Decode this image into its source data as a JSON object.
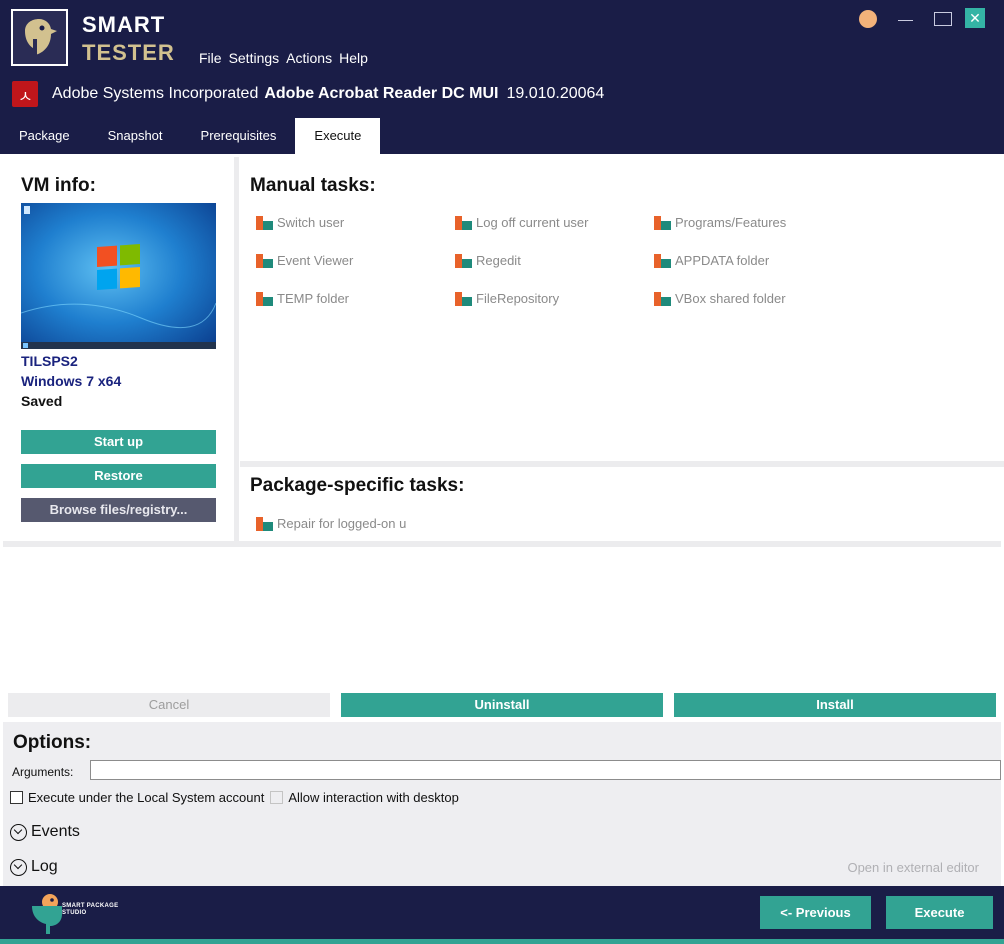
{
  "app": {
    "brand_line1": "SMART",
    "brand_line2": "TESTER",
    "colors": {
      "navy": "#1a1d47",
      "teal": "#32a393",
      "gold": "#d2c18f",
      "task_icon_orange": "#e8622a",
      "task_icon_teal": "#1f8a7b"
    }
  },
  "menu": [
    "File",
    "Settings",
    "Actions",
    "Help"
  ],
  "window_controls": {
    "user": "user-icon",
    "minimize": "minimize-icon",
    "maximize": "maximize-icon",
    "close": "close-icon",
    "close_glyph": "✕"
  },
  "product": {
    "vendor": "Adobe Systems Incorporated",
    "name": "Adobe Acrobat Reader DC MUI",
    "version": "19.010.20064"
  },
  "tabs": [
    {
      "label": "Package",
      "active": false
    },
    {
      "label": "Snapshot",
      "active": false
    },
    {
      "label": "Prerequisites",
      "active": false
    },
    {
      "label": "Execute",
      "active": true
    }
  ],
  "vm": {
    "title": "VM info:",
    "name": "TILSPS2",
    "os": "Windows 7 x64",
    "state": "Saved",
    "buttons": {
      "start": "Start up",
      "restore": "Restore",
      "browse": "Browse files/registry..."
    }
  },
  "manual_tasks": {
    "title": "Manual tasks:",
    "items": [
      "Switch user",
      "Log off current user",
      "Programs/Features",
      "Event Viewer",
      "Regedit",
      "APPDATA folder",
      "TEMP folder",
      "FileRepository",
      "VBox shared folder"
    ]
  },
  "package_tasks": {
    "title": "Package-specific tasks:",
    "items": [
      "Repair for logged-on u"
    ]
  },
  "actions": {
    "cancel": "Cancel",
    "uninstall": "Uninstall",
    "install": "Install"
  },
  "options": {
    "title": "Options:",
    "arguments_label": "Arguments:",
    "arguments_value": "",
    "local_system_label": "Execute under the Local System account",
    "local_system_checked": false,
    "interaction_label": "Allow interaction with desktop",
    "interaction_checked": false,
    "events_label": "Events",
    "log_label": "Log",
    "external_editor": "Open in external editor"
  },
  "footer": {
    "logo_line1": "SMART PACKAGE",
    "logo_line2": "STUDIO",
    "previous": "<- Previous",
    "execute": "Execute"
  }
}
